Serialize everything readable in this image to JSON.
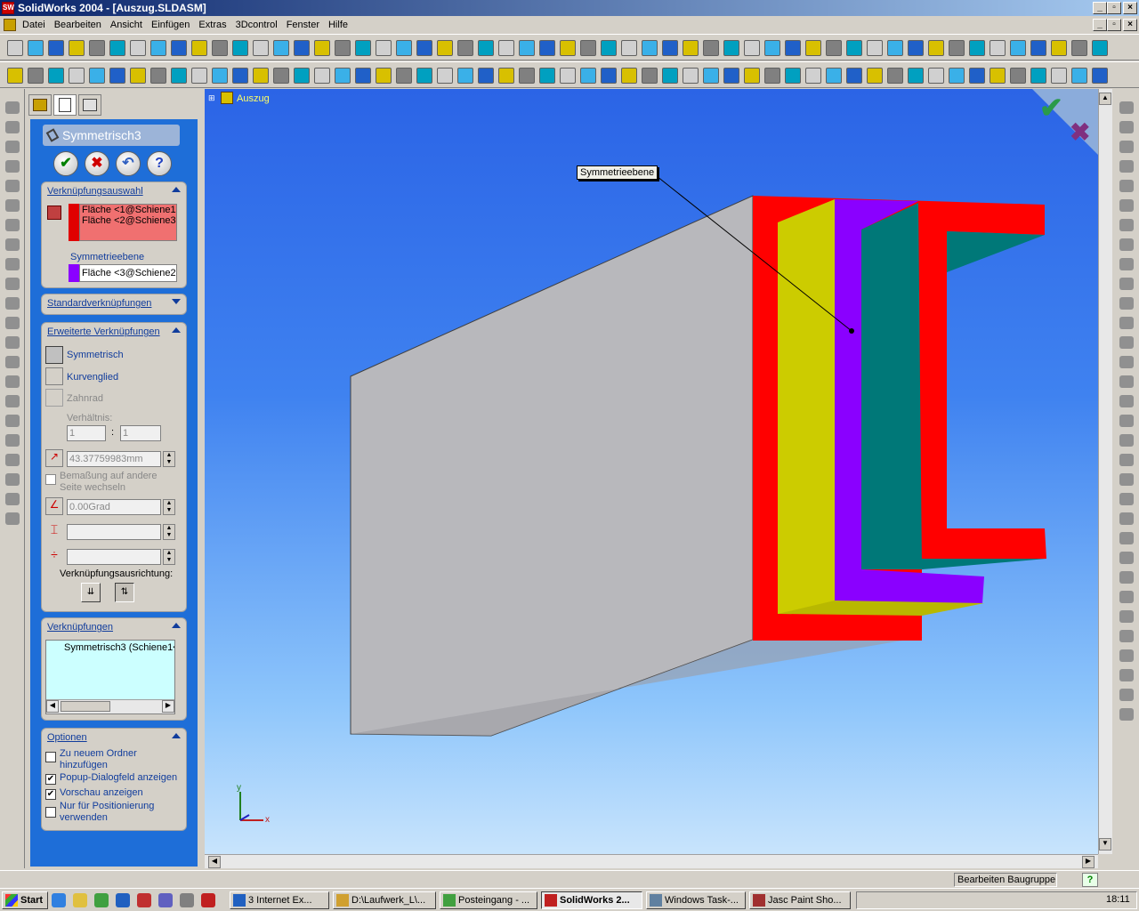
{
  "window": {
    "title": "SolidWorks 2004 - [Auszug.SLDASM]"
  },
  "menu": [
    "Datei",
    "Bearbeiten",
    "Ansicht",
    "Einfügen",
    "Extras",
    "3Dcontrol",
    "Fenster",
    "Hilfe"
  ],
  "panel": {
    "feature_title": "Symmetrisch3",
    "mate_selection": {
      "header": "Verknüpfungsauswahl",
      "entities": [
        "Fläche <1@Schiene1",
        "Fläche <2@Schiene3"
      ],
      "plane_label": "Symmetrieebene",
      "plane_entity": "Fläche <3@Schiene2"
    },
    "standard": {
      "header": "Standardverknüpfungen"
    },
    "advanced": {
      "header": "Erweiterte Verknüpfungen",
      "options": [
        "Symmetrisch",
        "Kurvenglied",
        "Zahnrad"
      ],
      "ratio_label": "Verhältnis:",
      "ratio_a": "1",
      "ratio_b": "1",
      "distance": "43.37759983mm",
      "flip_label_1": "Bemaßung auf andere",
      "flip_label_2": "Seite wechseln",
      "angle": "0.00Grad",
      "alignment_label": "Verknüpfungsausrichtung:"
    },
    "mates": {
      "header": "Verknüpfungen",
      "items": [
        "Symmetrisch3 (Schiene1<"
      ]
    },
    "options": {
      "header": "Optionen",
      "items": [
        {
          "label_1": "Zu neuem Ordner",
          "label_2": "hinzufügen",
          "checked": false
        },
        {
          "label_1": "Popup-Dialogfeld anzeigen",
          "label_2": "",
          "checked": true
        },
        {
          "label_1": "Vorschau anzeigen",
          "label_2": "",
          "checked": true
        },
        {
          "label_1": "Nur für Positionierung",
          "label_2": "verwenden",
          "checked": false
        }
      ]
    }
  },
  "viewport": {
    "tree_root": "Auszug",
    "callout": "Symmetrieebene",
    "axis_x": "x",
    "axis_y": "y"
  },
  "status": {
    "mode": "Bearbeiten Baugruppe",
    "help": "?"
  },
  "taskbar": {
    "start": "Start",
    "tasks": [
      "3 Internet Ex...",
      "D:\\Laufwerk_L\\...",
      "Posteingang - ...",
      "SolidWorks 2...",
      "Windows Task-...",
      "Jasc Paint Sho..."
    ],
    "time": "18:11"
  },
  "colors": {
    "red": "#ff0000",
    "yellow": "#cccc00",
    "purple": "#8a00ff",
    "teal": "#007878",
    "gray": "#b8b8bc"
  }
}
